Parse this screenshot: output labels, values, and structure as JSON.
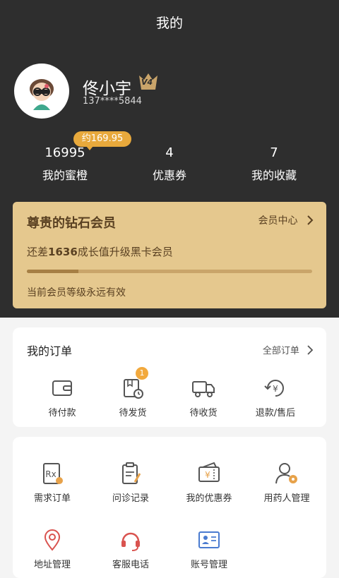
{
  "header": {
    "title": "我的"
  },
  "user": {
    "name": "佟小宇",
    "level": "V4",
    "phone": "137****5844"
  },
  "stats": {
    "tip": "约169.95",
    "items": [
      {
        "value": "16995",
        "label": "我的蜜橙"
      },
      {
        "value": "4",
        "label": "优惠券"
      },
      {
        "value": "7",
        "label": "我的收藏"
      }
    ]
  },
  "vip": {
    "title": "尊贵的钻石会员",
    "center_link": "会员中心",
    "growth_prefix": "还差",
    "growth_value": "1636",
    "growth_suffix": "成长值升级黑卡会员",
    "progress": 0.18,
    "validity": "当前会员等级永远有效"
  },
  "orders": {
    "title": "我的订单",
    "all_link": "全部订单",
    "items": [
      {
        "label": "待付款",
        "icon": "wallet-icon"
      },
      {
        "label": "待发货",
        "icon": "package-clock-icon",
        "badge": "1"
      },
      {
        "label": "待收货",
        "icon": "truck-icon"
      },
      {
        "label": "退款/售后",
        "icon": "refund-icon"
      }
    ]
  },
  "services": {
    "items": [
      {
        "label": "需求订单",
        "icon": "prescription-icon"
      },
      {
        "label": "问诊记录",
        "icon": "clipboard-pen-icon"
      },
      {
        "label": "我的优惠券",
        "icon": "coupon-icon"
      },
      {
        "label": "用药人管理",
        "icon": "user-gear-icon"
      },
      {
        "label": "地址管理",
        "icon": "location-pin-icon"
      },
      {
        "label": "客服电话",
        "icon": "headset-icon"
      },
      {
        "label": "账号管理",
        "icon": "id-card-icon"
      }
    ]
  },
  "colors": {
    "header_bg": "#2e2e2e",
    "gold": "#e5c88e",
    "accent": "#e8a93c",
    "icon": "#555555",
    "icon_accent": "#e7a24a"
  }
}
